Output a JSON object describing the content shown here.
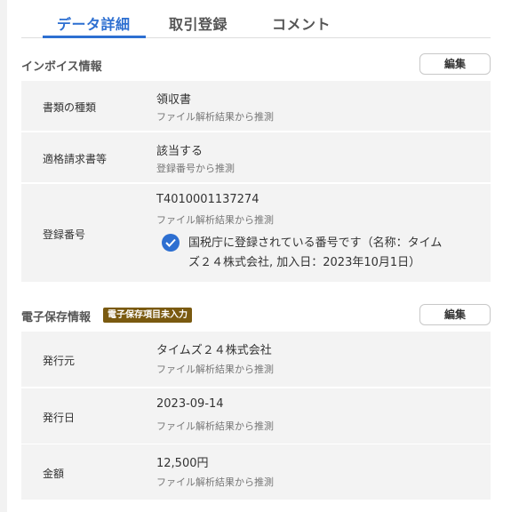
{
  "tabs": [
    {
      "label": "データ詳細"
    },
    {
      "label": "取引登録"
    },
    {
      "label": "コメント"
    }
  ],
  "invoice": {
    "title": "インボイス情報",
    "edit_label": "編集",
    "rows": [
      {
        "label": "書類の種類",
        "value": "領収書",
        "sub": "ファイル解析結果から推測"
      },
      {
        "label": "適格請求書等",
        "value": "該当する",
        "sub": "登録番号から推測"
      },
      {
        "label": "登録番号",
        "value": "T4010001137274",
        "sub": "ファイル解析結果から推測",
        "verify_line1": "国税庁に登録されている番号です（名称：タイム",
        "verify_line2": "ズ２４株式会社, 加入日：2023年10月1日）"
      }
    ]
  },
  "storage": {
    "title": "電子保存情報",
    "badge": "電子保存項目未入力",
    "edit_label": "編集",
    "rows": [
      {
        "label": "発行元",
        "value": "タイムズ２４株式会社",
        "sub": "ファイル解析結果から推測"
      },
      {
        "label": "発行日",
        "value": "2023-09-14",
        "sub": "ファイル解析結果から推測"
      },
      {
        "label": "金額",
        "value": "12,500円",
        "sub": "ファイル解析結果から推測"
      }
    ]
  },
  "colors": {
    "accent": "#2d6fd1",
    "badge": "#7a5a10",
    "row_bg": "#f3f3f3"
  },
  "icons": {
    "verified": "check-circle-icon"
  }
}
